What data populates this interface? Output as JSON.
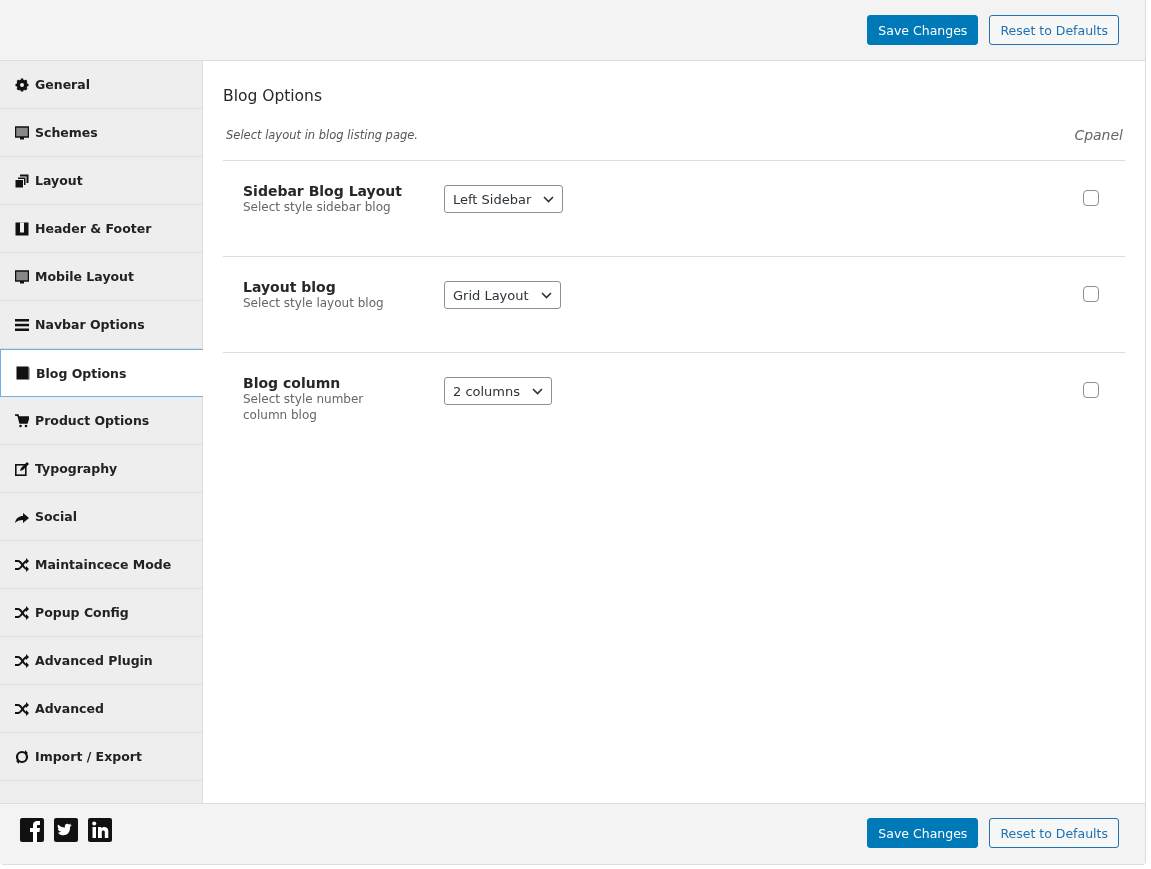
{
  "header": {
    "buttons": [
      {
        "label": "Save Changes",
        "kind": "primary"
      },
      {
        "label": "Reset to Defaults",
        "kind": "secondary"
      }
    ]
  },
  "sidebar": {
    "items": [
      {
        "label": "General",
        "selected": false
      },
      {
        "label": "Schemes",
        "selected": false
      },
      {
        "label": "Layout",
        "selected": false
      },
      {
        "label": "Header & Footer",
        "selected": false
      },
      {
        "label": "Mobile Layout",
        "selected": false
      },
      {
        "label": "Navbar Options",
        "selected": false
      },
      {
        "label": "Blog Options",
        "selected": true
      },
      {
        "label": "Product Options",
        "selected": false
      },
      {
        "label": "Typography",
        "selected": false
      },
      {
        "label": "Social",
        "selected": false
      },
      {
        "label": "Maintaincece Mode",
        "selected": false
      },
      {
        "label": "Popup Config",
        "selected": false
      },
      {
        "label": "Advanced Plugin",
        "selected": false
      },
      {
        "label": "Advanced",
        "selected": false
      },
      {
        "label": "Import / Export",
        "selected": false
      }
    ]
  },
  "content": {
    "title": "Blog Options",
    "description": "Select layout in blog listing page.",
    "side_label": "Cpanel",
    "settings": [
      {
        "label": "Sidebar Blog Layout",
        "hint": "Select style sidebar blog",
        "value": "Left Sidebar",
        "checked": false
      },
      {
        "label": "Layout blog",
        "hint": "Select style layout blog",
        "value": "Grid Layout",
        "checked": false
      },
      {
        "label": "Blog column",
        "hint": "Select style number column blog",
        "value": "2 columns",
        "checked": false
      }
    ]
  },
  "footer": {
    "buttons": [
      {
        "label": "Save Changes",
        "kind": "primary"
      },
      {
        "label": "Reset to Defaults",
        "kind": "secondary"
      }
    ]
  }
}
